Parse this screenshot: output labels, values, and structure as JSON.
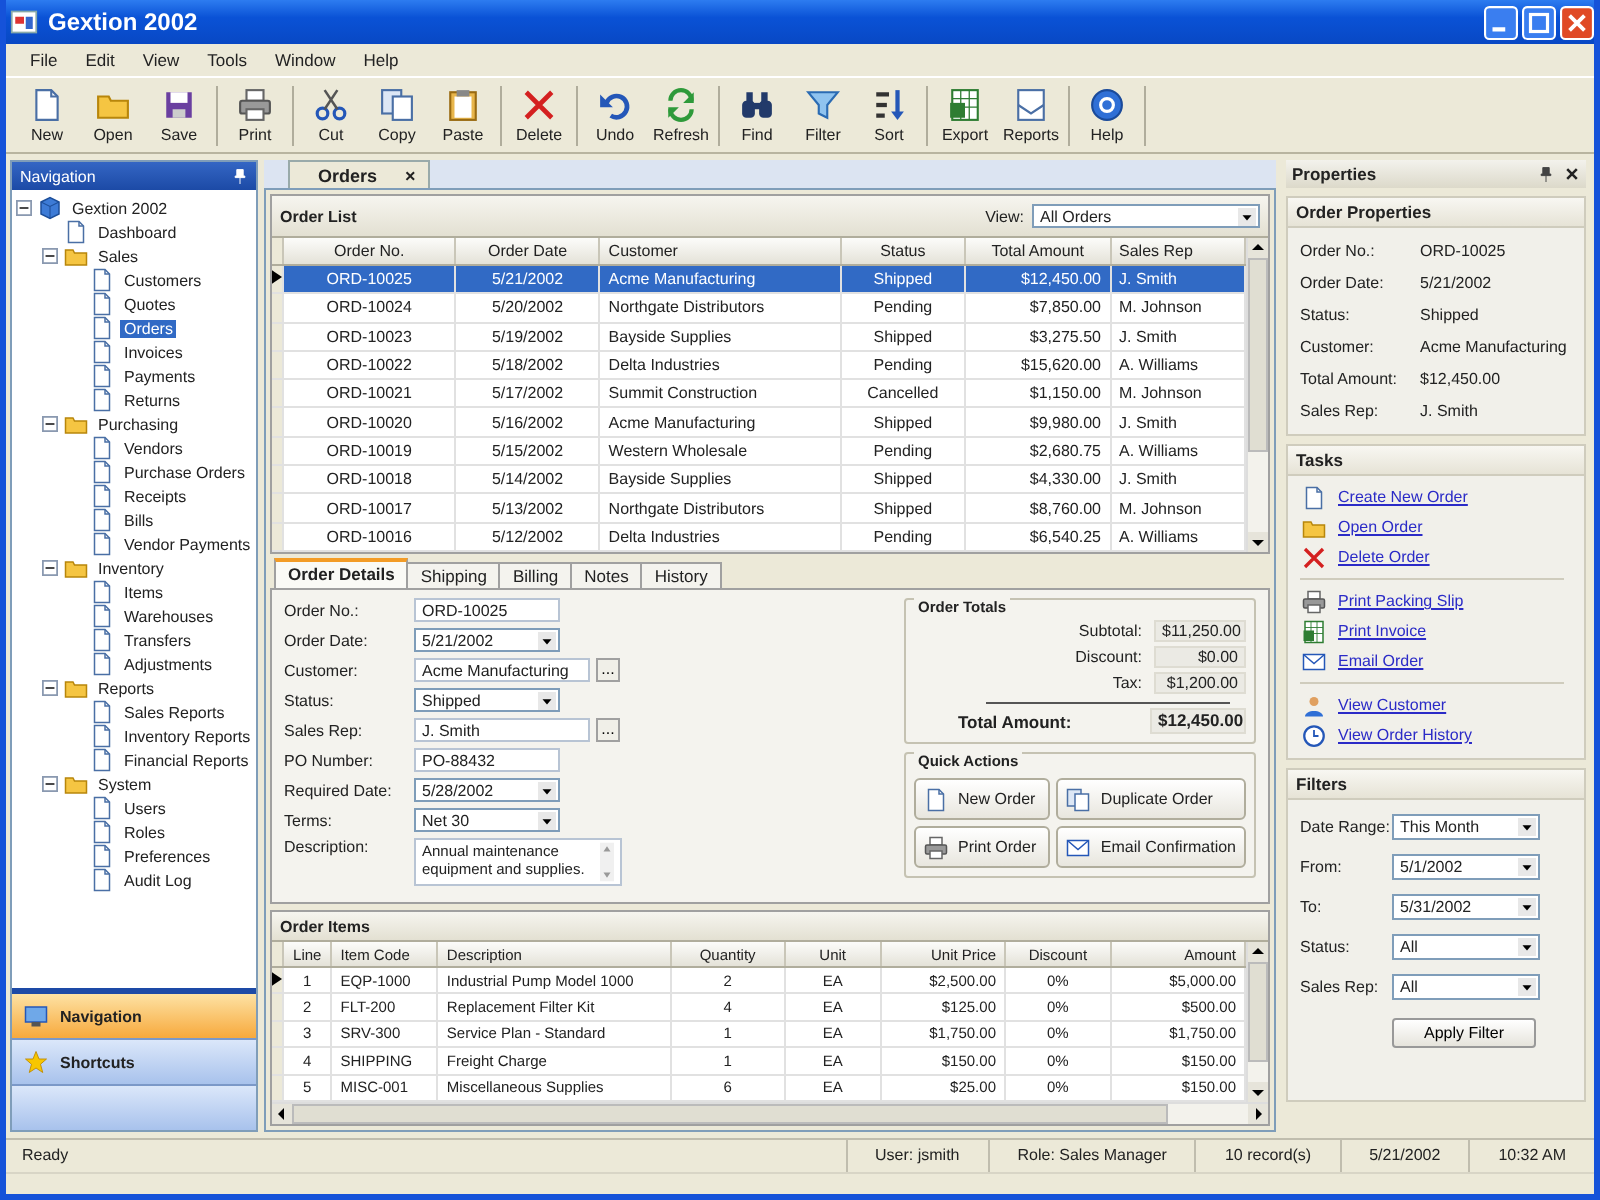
{
  "window": {
    "title": "Gextion 2002"
  },
  "menu": [
    "File",
    "Edit",
    "View",
    "Tools",
    "Window",
    "Help"
  ],
  "toolbar": [
    [
      "New",
      "Open",
      "Save"
    ],
    [
      "Print"
    ],
    [
      "Cut",
      "Copy",
      "Paste"
    ],
    [
      "Delete"
    ],
    [
      "Undo",
      "Refresh"
    ],
    [
      "Find",
      "Filter",
      "Sort"
    ],
    [
      "Export",
      "Reports"
    ],
    [
      "Help"
    ]
  ],
  "navigation": {
    "title": "Navigation",
    "tree": [
      {
        "label": "Gextion 2002",
        "expanded": true,
        "selected": false,
        "children": [
          {
            "label": "Dashboard",
            "selected": false
          },
          {
            "label": "Sales",
            "expanded": true,
            "selected": false,
            "children": [
              {
                "label": "Customers",
                "selected": false
              },
              {
                "label": "Quotes",
                "selected": false
              },
              {
                "label": "Orders",
                "selected": true
              },
              {
                "label": "Invoices",
                "selected": false
              },
              {
                "label": "Payments",
                "selected": false
              },
              {
                "label": "Returns",
                "selected": false
              }
            ]
          },
          {
            "label": "Purchasing",
            "expanded": true,
            "selected": false,
            "children": [
              {
                "label": "Vendors",
                "selected": false
              },
              {
                "label": "Purchase Orders",
                "selected": false
              },
              {
                "label": "Receipts",
                "selected": false
              },
              {
                "label": "Bills",
                "selected": false
              },
              {
                "label": "Vendor Payments",
                "selected": false
              }
            ]
          },
          {
            "label": "Inventory",
            "expanded": true,
            "selected": false,
            "children": [
              {
                "label": "Items",
                "selected": false
              },
              {
                "label": "Warehouses",
                "selected": false
              },
              {
                "label": "Transfers",
                "selected": false
              },
              {
                "label": "Adjustments",
                "selected": false
              }
            ]
          },
          {
            "label": "Reports",
            "expanded": true,
            "selected": false,
            "children": [
              {
                "label": "Sales Reports",
                "selected": false
              },
              {
                "label": "Inventory Reports",
                "selected": false
              },
              {
                "label": "Financial Reports",
                "selected": false
              }
            ]
          },
          {
            "label": "System",
            "expanded": true,
            "selected": false,
            "children": [
              {
                "label": "Users",
                "selected": false
              },
              {
                "label": "Roles",
                "selected": false
              },
              {
                "label": "Preferences",
                "selected": false
              },
              {
                "label": "Audit Log",
                "selected": false
              }
            ]
          }
        ]
      }
    ],
    "panes": [
      {
        "label": "Navigation",
        "selected": true
      },
      {
        "label": "Shortcuts",
        "selected": false
      }
    ]
  },
  "document_tabs": [
    {
      "label": "Orders",
      "selected": true,
      "close": "×"
    }
  ],
  "order_list": {
    "title": "Order List",
    "view_label": "View:",
    "view_value": "All Orders",
    "columns": [
      "Order No.",
      "Order Date",
      "Customer",
      "Status",
      "Total Amount",
      "Sales Rep"
    ],
    "rows": [
      {
        "selected": true,
        "cells": [
          "ORD-10025",
          "5/21/2002",
          "Acme Manufacturing",
          "Shipped",
          "$12,450.00",
          "J. Smith"
        ]
      },
      {
        "selected": false,
        "cells": [
          "ORD-10024",
          "5/20/2002",
          "Northgate Distributors",
          "Pending",
          "$7,850.00",
          "M. Johnson"
        ]
      },
      {
        "selected": false,
        "cells": [
          "ORD-10023",
          "5/19/2002",
          "Bayside Supplies",
          "Shipped",
          "$3,275.50",
          "J. Smith"
        ]
      },
      {
        "selected": false,
        "cells": [
          "ORD-10022",
          "5/18/2002",
          "Delta Industries",
          "Pending",
          "$15,620.00",
          "A. Williams"
        ]
      },
      {
        "selected": false,
        "cells": [
          "ORD-10021",
          "5/17/2002",
          "Summit Construction",
          "Cancelled",
          "$1,150.00",
          "M. Johnson"
        ]
      },
      {
        "selected": false,
        "cells": [
          "ORD-10020",
          "5/16/2002",
          "Acme Manufacturing",
          "Shipped",
          "$9,980.00",
          "J. Smith"
        ]
      },
      {
        "selected": false,
        "cells": [
          "ORD-10019",
          "5/15/2002",
          "Western Wholesale",
          "Pending",
          "$2,680.75",
          "A. Williams"
        ]
      },
      {
        "selected": false,
        "cells": [
          "ORD-10018",
          "5/14/2002",
          "Bayside Supplies",
          "Shipped",
          "$4,330.00",
          "J. Smith"
        ]
      },
      {
        "selected": false,
        "cells": [
          "ORD-10017",
          "5/13/2002",
          "Northgate Distributors",
          "Shipped",
          "$8,760.00",
          "M. Johnson"
        ]
      },
      {
        "selected": false,
        "cells": [
          "ORD-10016",
          "5/12/2002",
          "Delta Industries",
          "Pending",
          "$6,540.25",
          "A. Williams"
        ]
      }
    ]
  },
  "details": {
    "tabs": [
      {
        "label": "Order Details",
        "selected": true
      },
      {
        "label": "Shipping",
        "selected": false
      },
      {
        "label": "Billing",
        "selected": false
      },
      {
        "label": "Notes",
        "selected": false
      },
      {
        "label": "History",
        "selected": false
      }
    ],
    "fields": [
      {
        "kind": "text",
        "label": "Order No.:",
        "value": "ORD-10025"
      },
      {
        "kind": "select",
        "label": "Order Date:",
        "value": "5/21/2002"
      },
      {
        "kind": "lookup",
        "label": "Customer:",
        "value": "Acme Manufacturing",
        "button": "..."
      },
      {
        "kind": "select",
        "label": "Status:",
        "value": "Shipped"
      },
      {
        "kind": "lookup",
        "label": "Sales Rep:",
        "value": "J. Smith",
        "button": "..."
      },
      {
        "kind": "text",
        "label": "PO Number:",
        "value": "PO-88432"
      },
      {
        "kind": "select",
        "label": "Required Date:",
        "value": "5/28/2002"
      },
      {
        "kind": "select",
        "label": "Terms:",
        "value": "Net 30"
      },
      {
        "kind": "textarea",
        "label": "Description:",
        "value": "Annual maintenance equipment and supplies."
      }
    ],
    "totals": {
      "title": "Order Totals",
      "rows": [
        {
          "label": "Subtotal:",
          "value": "$11,250.00"
        },
        {
          "label": "Discount:",
          "value": "$0.00"
        },
        {
          "label": "Tax:",
          "value": "$1,200.00"
        }
      ],
      "total": {
        "label": "Total Amount:",
        "value": "$12,450.00"
      }
    },
    "quick_actions": {
      "title": "Quick Actions",
      "buttons": [
        "New Order",
        "Duplicate Order",
        "Print Order",
        "Email Confirmation"
      ]
    }
  },
  "order_items": {
    "title": "Order Items",
    "columns": [
      "Line",
      "Item Code",
      "Description",
      "Quantity",
      "Unit",
      "Unit Price",
      "Discount",
      "Amount"
    ],
    "rows": [
      {
        "current": true,
        "cells": [
          "1",
          "EQP-1000",
          "Industrial Pump Model 1000",
          "2",
          "EA",
          "$2,500.00",
          "0%",
          "$5,000.00"
        ]
      },
      {
        "current": false,
        "cells": [
          "2",
          "FLT-200",
          "Replacement Filter Kit",
          "4",
          "EA",
          "$125.00",
          "0%",
          "$500.00"
        ]
      },
      {
        "current": false,
        "cells": [
          "3",
          "SRV-300",
          "Service Plan - Standard",
          "1",
          "EA",
          "$1,750.00",
          "0%",
          "$1,750.00"
        ]
      },
      {
        "current": false,
        "cells": [
          "4",
          "SHIPPING",
          "Freight Charge",
          "1",
          "EA",
          "$150.00",
          "0%",
          "$150.00"
        ]
      },
      {
        "current": false,
        "cells": [
          "5",
          "MISC-001",
          "Miscellaneous Supplies",
          "6",
          "EA",
          "$25.00",
          "0%",
          "$150.00"
        ]
      }
    ]
  },
  "properties": {
    "title": "Properties",
    "order_properties": {
      "title": "Order Properties",
      "rows": [
        {
          "label": "Order No.:",
          "value": "ORD-10025"
        },
        {
          "label": "Order Date:",
          "value": "5/21/2002"
        },
        {
          "label": "Status:",
          "value": "Shipped"
        },
        {
          "label": "Customer:",
          "value": "Acme Manufacturing"
        },
        {
          "label": "Total Amount:",
          "value": "$12,450.00"
        },
        {
          "label": "Sales Rep:",
          "value": "J. Smith"
        }
      ]
    },
    "tasks": {
      "title": "Tasks",
      "groups": [
        [
          "Create New Order",
          "Open Order",
          "Delete Order"
        ],
        [
          "Print Packing Slip",
          "Print Invoice",
          "Email Order"
        ],
        [
          "View Customer",
          "View Order History"
        ]
      ]
    },
    "filters": {
      "title": "Filters",
      "fields": [
        {
          "label": "Date Range:",
          "value": "This Month"
        },
        {
          "label": "From:",
          "value": "5/1/2002"
        },
        {
          "label": "To:",
          "value": "5/31/2002"
        },
        {
          "label": "Status:",
          "value": "All"
        },
        {
          "label": "Sales Rep:",
          "value": "All"
        }
      ],
      "button": "Apply Filter"
    }
  },
  "status_bar": [
    "Ready",
    "User: jsmith",
    "Role: Sales Manager",
    "10 record(s)",
    "5/21/2002",
    "10:32 AM"
  ]
}
